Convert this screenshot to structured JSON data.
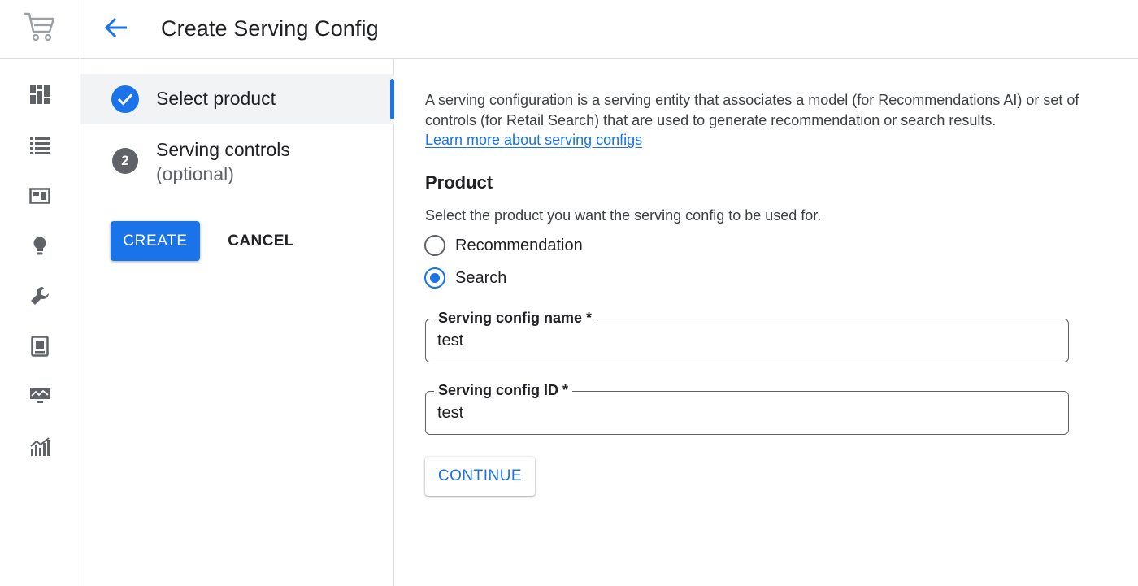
{
  "header": {
    "title": "Create Serving Config",
    "back_icon": "arrow-back-icon"
  },
  "rail": {
    "logo_icon": "shopping-cart-icon",
    "items": [
      {
        "icon": "dashboard-icon"
      },
      {
        "icon": "list-icon"
      },
      {
        "icon": "catalog-icon"
      },
      {
        "icon": "lightbulb-icon"
      },
      {
        "icon": "wrench-icon"
      },
      {
        "icon": "portrait-icon"
      },
      {
        "icon": "monitor-icon"
      },
      {
        "icon": "analytics-icon"
      }
    ]
  },
  "stepper": {
    "steps": [
      {
        "label": "Select product",
        "status": "complete"
      },
      {
        "number": "2",
        "label": "Serving controls",
        "sublabel": "(optional)"
      }
    ],
    "create_label": "CREATE",
    "cancel_label": "CANCEL"
  },
  "main": {
    "intro": "A serving configuration is a serving entity that associates a model (for Recommendations AI) or set of controls (for Retail Search) that are used to generate recommendation or search results.",
    "learn_more": "Learn more about serving configs",
    "product": {
      "title": "Product",
      "description": "Select the product you want the serving config to be used for.",
      "options": [
        {
          "label": "Recommendation",
          "selected": false
        },
        {
          "label": "Search",
          "selected": true
        }
      ]
    },
    "fields": {
      "name": {
        "label": "Serving config name *",
        "value": "test"
      },
      "id": {
        "label": "Serving config ID *",
        "value": "test"
      }
    },
    "continue_label": "CONTINUE"
  },
  "colors": {
    "accent": "#1a73e8",
    "icon_gray": "#5f6368",
    "divider": "#dadce0",
    "active_step_bg": "#f1f3f4"
  }
}
